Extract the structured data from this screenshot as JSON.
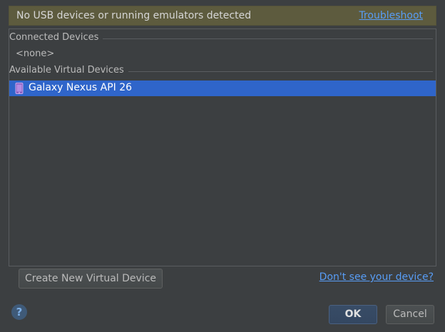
{
  "banner": {
    "message": "No USB devices or running emulators detected",
    "troubleshoot_label": "Troubleshoot"
  },
  "connected_devices": {
    "header": "Connected Devices",
    "none_label": "<none>"
  },
  "available_virtual_devices": {
    "header": "Available Virtual Devices",
    "items": [
      {
        "label": "Galaxy Nexus API 26",
        "icon": "phone-icon",
        "selected": true
      }
    ]
  },
  "actions": {
    "create_label": "Create New Virtual Device",
    "dont_see_label": "Don't see your device?",
    "help_label": "?",
    "ok_label": "OK",
    "cancel_label": "Cancel"
  },
  "colors": {
    "background": "#3c3f41",
    "banner": "#5d5b3e",
    "selection": "#2f65ca",
    "link": "#589df6"
  }
}
